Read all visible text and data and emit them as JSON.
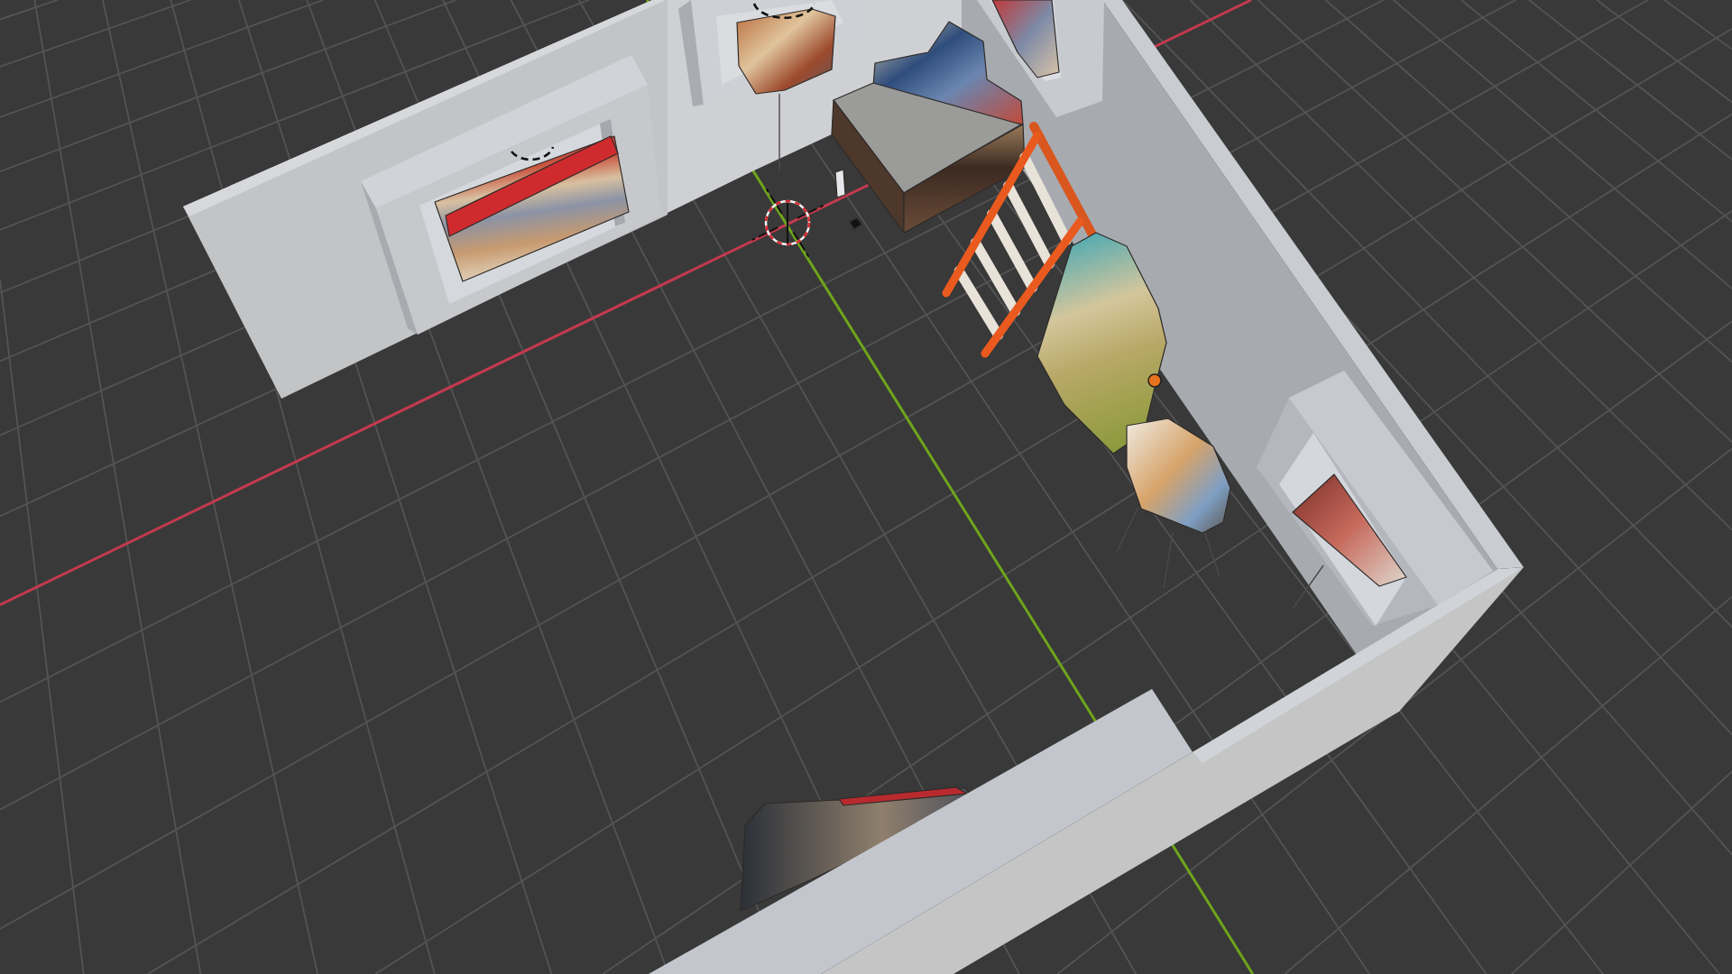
{
  "viewport": {
    "grid": true,
    "axes": [
      {
        "color": "#c33a4e"
      },
      {
        "color": "#6ea51c"
      }
    ],
    "objects": [
      {
        "kind": "wall",
        "selected": false
      },
      {
        "kind": "wall",
        "selected": false
      },
      {
        "kind": "scan",
        "selected": false
      },
      {
        "kind": "light",
        "selected": false
      },
      {
        "kind": "scan",
        "selected": false
      },
      {
        "kind": "light",
        "selected": false
      },
      {
        "kind": "scan",
        "selected": false
      },
      {
        "kind": "scan",
        "selected": false
      },
      {
        "kind": "scan",
        "selected": false
      },
      {
        "kind": "scan",
        "selected": false
      },
      {
        "kind": "ladder",
        "selected": false
      },
      {
        "kind": "scan",
        "selected": true
      },
      {
        "kind": "scan",
        "selected": false
      },
      {
        "kind": "scan",
        "selected": false
      },
      {
        "kind": "scan",
        "selected": false
      },
      {
        "kind": "wall",
        "selected": false
      }
    ],
    "cursor_3d": true
  }
}
